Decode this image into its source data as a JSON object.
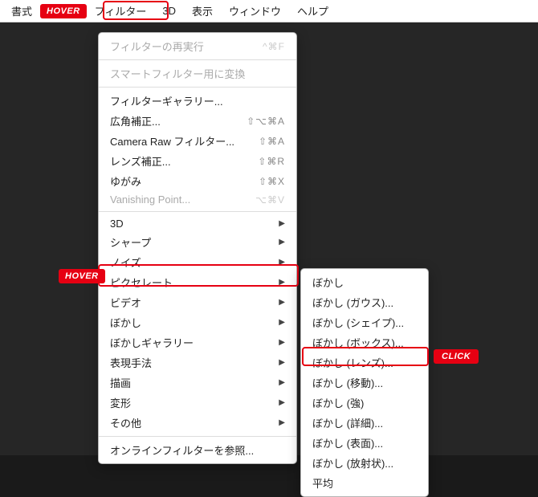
{
  "menubar": {
    "items": [
      "書式",
      "フィルター",
      "3D",
      "表示",
      "ウィンドウ",
      "ヘルプ"
    ]
  },
  "annotations": {
    "hover": "HOVER",
    "click": "CLICK"
  },
  "filterMenu": {
    "reexec": {
      "label": "フィルターの再実行",
      "shortcut": "^⌘F"
    },
    "smart": {
      "label": "スマートフィルター用に変換"
    },
    "gallery": {
      "label": "フィルターギャラリー..."
    },
    "wide": {
      "label": "広角補正...",
      "shortcut": "⇧⌥⌘A"
    },
    "camera": {
      "label": "Camera Raw フィルター...",
      "shortcut": "⇧⌘A"
    },
    "lens": {
      "label": "レンズ補正...",
      "shortcut": "⇧⌘R"
    },
    "liquify": {
      "label": "ゆがみ",
      "shortcut": "⇧⌘X"
    },
    "vanish": {
      "label": "Vanishing Point...",
      "shortcut": "⌥⌘V"
    },
    "sub3d": {
      "label": "3D"
    },
    "sharpen": {
      "label": "シャープ"
    },
    "noise": {
      "label": "ノイズ"
    },
    "pixelate": {
      "label": "ピクセレート"
    },
    "video": {
      "label": "ビデオ"
    },
    "blur": {
      "label": "ぼかし"
    },
    "blurGallery": {
      "label": "ぼかしギャラリー"
    },
    "render": {
      "label": "表現手法"
    },
    "sketch": {
      "label": "描画"
    },
    "distort": {
      "label": "変形"
    },
    "other": {
      "label": "その他"
    },
    "online": {
      "label": "オンラインフィルターを参照..."
    }
  },
  "blurSubmenu": {
    "blur": "ぼかし",
    "gauss": "ぼかし (ガウス)...",
    "shape": "ぼかし (シェイプ)...",
    "box": "ぼかし (ボックス)...",
    "lens": "ぼかし (レンズ)...",
    "motion": "ぼかし (移動)...",
    "more": "ぼかし (強)",
    "detail": "ぼかし (詳細)...",
    "surface": "ぼかし (表面)...",
    "radial": "ぼかし (放射状)...",
    "average": "平均"
  }
}
